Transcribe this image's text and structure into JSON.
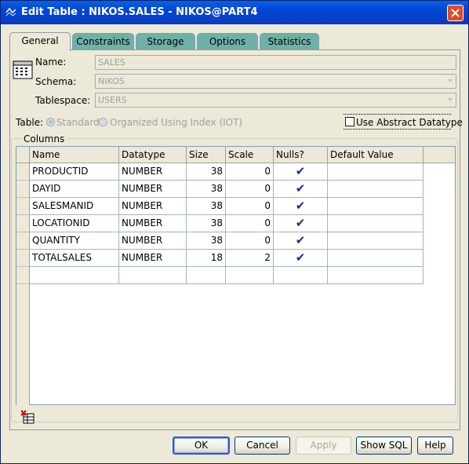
{
  "window": {
    "title": "Edit Table : NIKOS.SALES - NIKOS@PART4"
  },
  "tabs": [
    {
      "label": "General",
      "active": true
    },
    {
      "label": "Constraints",
      "active": false
    },
    {
      "label": "Storage",
      "active": false
    },
    {
      "label": "Options",
      "active": false
    },
    {
      "label": "Statistics",
      "active": false
    }
  ],
  "form": {
    "name_label": "Name:",
    "name_value": "SALES",
    "schema_label": "Schema:",
    "schema_value": "NIKOS",
    "tablespace_label": "Tablespace:",
    "tablespace_value": "USERS",
    "table_label": "Table:",
    "radio_standard": "Standard",
    "radio_iot": "Organized Using Index (IOT)",
    "abstract_label": "Use Abstract Datatype"
  },
  "columns_group": {
    "label": "Columns",
    "headers": [
      "Name",
      "Datatype",
      "Size",
      "Scale",
      "Nulls?",
      "Default Value"
    ],
    "rows": [
      {
        "name": "PRODUCTID",
        "datatype": "NUMBER",
        "size": "38",
        "scale": "0",
        "nulls": "✔",
        "default": ""
      },
      {
        "name": "DAYID",
        "datatype": "NUMBER",
        "size": "38",
        "scale": "0",
        "nulls": "✔",
        "default": ""
      },
      {
        "name": "SALESMANID",
        "datatype": "NUMBER",
        "size": "38",
        "scale": "0",
        "nulls": "✔",
        "default": ""
      },
      {
        "name": "LOCATIONID",
        "datatype": "NUMBER",
        "size": "38",
        "scale": "0",
        "nulls": "✔",
        "default": ""
      },
      {
        "name": "QUANTITY",
        "datatype": "NUMBER",
        "size": "38",
        "scale": "0",
        "nulls": "✔",
        "default": ""
      },
      {
        "name": "TOTALSALES",
        "datatype": "NUMBER",
        "size": "18",
        "scale": "2",
        "nulls": "✔",
        "default": ""
      }
    ]
  },
  "buttons": {
    "ok": "OK",
    "cancel": "Cancel",
    "apply": "Apply",
    "show_sql": "Show SQL",
    "help": "Help"
  },
  "icons": {
    "title": "oracle-app-icon",
    "close": "close-icon",
    "table": "table-icon",
    "delete_row": "delete-row-icon"
  },
  "colors": {
    "titlebar": "#0a46d6",
    "tab_inactive": "#6fb1a6",
    "check": "#1c2a8f"
  }
}
